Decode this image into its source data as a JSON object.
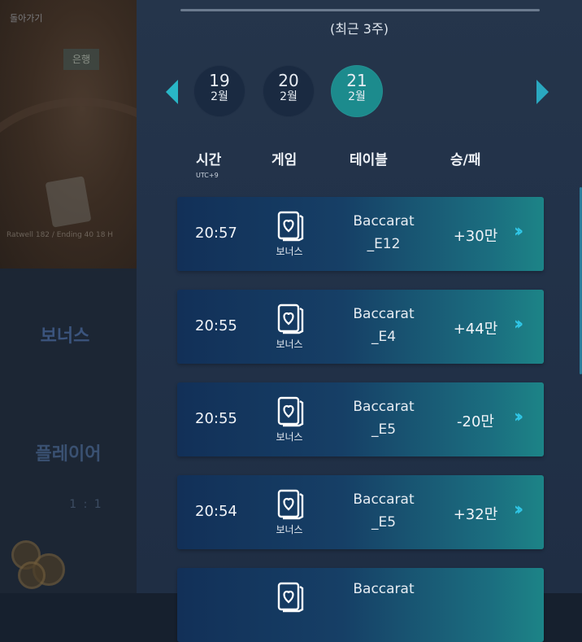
{
  "backdrop": {
    "back_label": "돌아가기",
    "sign_text": "은행",
    "info_text": "Ratwell 182 / Ending 40 18 H",
    "bonus_label": "보너스",
    "player_label": "플레이어",
    "ratio": "1 : 1"
  },
  "history": {
    "period_label": "(최근 3주)",
    "dates": [
      {
        "day": "19",
        "month": "2월",
        "active": false
      },
      {
        "day": "20",
        "month": "2월",
        "active": false
      },
      {
        "day": "21",
        "month": "2월",
        "active": true
      }
    ],
    "columns": {
      "time": "시간",
      "time_sub": "UTC+9",
      "game": "게임",
      "table": "테이블",
      "result": "승/패"
    },
    "rows": [
      {
        "time": "20:57",
        "game": "보너스",
        "table_line1": "Baccarat",
        "table_line2": "_E12",
        "result": "+30만"
      },
      {
        "time": "20:55",
        "game": "보너스",
        "table_line1": "Baccarat",
        "table_line2": "_E4",
        "result": "+44만"
      },
      {
        "time": "20:55",
        "game": "보너스",
        "table_line1": "Baccarat",
        "table_line2": "_E5",
        "result": "-20만"
      },
      {
        "time": "20:54",
        "game": "보너스",
        "table_line1": "Baccarat",
        "table_line2": "_E5",
        "result": "+32만"
      },
      {
        "time": "",
        "game": "",
        "table_line1": "Baccarat",
        "table_line2": "",
        "result": ""
      }
    ],
    "icons": {
      "prev": "chevron-left-icon",
      "next": "chevron-right-icon",
      "detail": "double-chevron-right-icon",
      "game": "playing-card-icon"
    },
    "colors": {
      "accent": "#1c8b8d",
      "arrow": "#29b6c6",
      "row_start": "#123058",
      "row_end": "#1c8487"
    }
  }
}
